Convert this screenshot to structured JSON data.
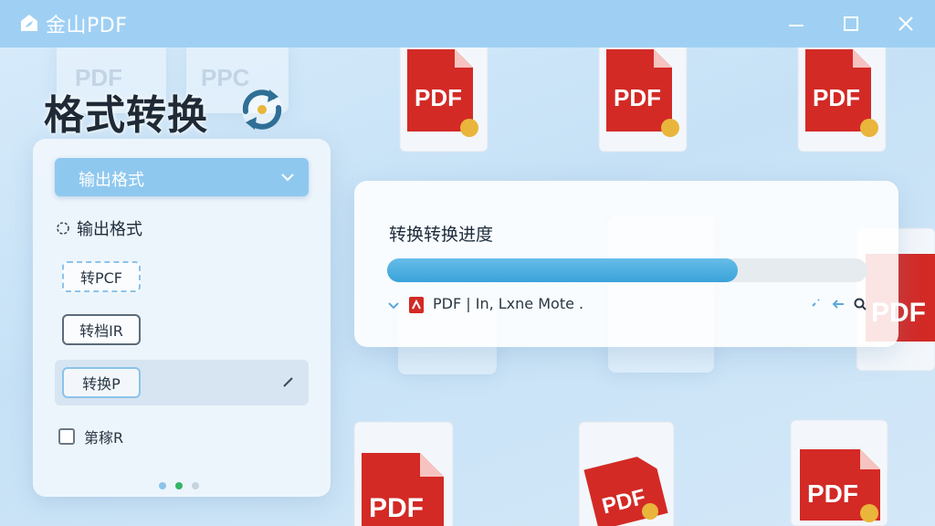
{
  "titlebar": {
    "app_name": "金山PDF",
    "logo_icon": "kingsoft-logo-icon",
    "minimize_icon": "minimize-icon",
    "maximize_icon": "maximize-icon",
    "close_icon": "close-icon"
  },
  "heading": {
    "title": "格式转换",
    "icon": "refresh-icon"
  },
  "settings": {
    "dropdown_label": "输出格式",
    "section_label": "输出格式",
    "options": [
      {
        "label": "转PCF"
      },
      {
        "label": "转档IR"
      },
      {
        "label": "转换P"
      }
    ],
    "checkbox_label": "第稼R",
    "pager_active_index": 1
  },
  "progress": {
    "title": "转换转换进度",
    "percent": 73,
    "file_type": "PDF",
    "file_status": "In, Lxne Mote .",
    "file_icon": "pdf-file-icon"
  },
  "background": {
    "doc_label": "PDF",
    "ghost_labels": [
      "PDF",
      "PPC"
    ]
  },
  "colors": {
    "accent": "#3aa2d9",
    "titlebar": "#9fd0f3",
    "pdf_red": "#d32a26",
    "badge_gold": "#e9b53b"
  }
}
